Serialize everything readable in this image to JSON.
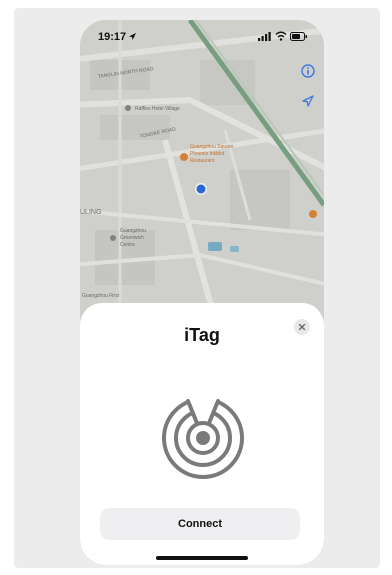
{
  "status_bar": {
    "time": "19:17"
  },
  "map": {
    "labels": [
      "TANGLIN NORTH ROAD",
      "Raffles Hotel Village",
      "TONGKE ROAD",
      "Guangzhou Square",
      "Phoenix Inkblot",
      "Restaurant",
      "ULING",
      "Guangzhou",
      "Greenwich",
      "Centre",
      "Guangzhou First"
    ]
  },
  "sheet": {
    "title": "iTag",
    "connect_label": "Connect"
  }
}
